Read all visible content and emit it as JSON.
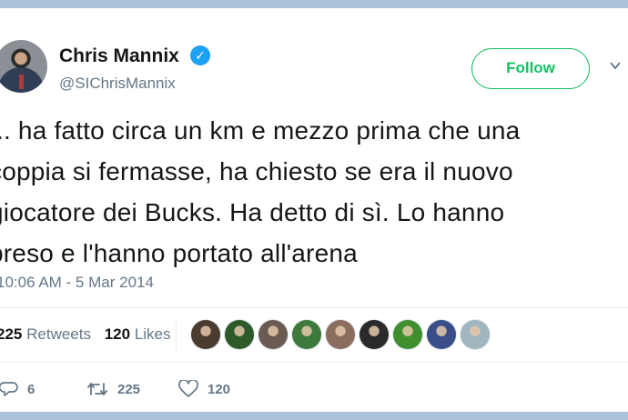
{
  "author": {
    "display_name": "Chris Mannix",
    "handle": "@SIChrisMannix",
    "verified": true
  },
  "follow_label": "Follow",
  "tweet": {
    "lines": [
      "... ha fatto circa un km e mezzo prima che una",
      "coppia si fermasse, ha chiesto se era il nuovo",
      "giocatore dei Bucks. Ha detto di sì. Lo hanno",
      "preso e l'hanno portato all'arena"
    ],
    "timestamp": "10:06 AM - 5 Mar 2014"
  },
  "stats": {
    "retweets_count": "225",
    "retweets_label": "Retweets",
    "likes_count": "120",
    "likes_label": "Likes"
  },
  "likers": [
    {
      "icon": "liker-avatar-1",
      "color": "#4a3b2f"
    },
    {
      "icon": "liker-avatar-2",
      "color": "#2e5a2a"
    },
    {
      "icon": "liker-avatar-3",
      "color": "#6b5a52"
    },
    {
      "icon": "liker-avatar-4",
      "color": "#3e7a3c"
    },
    {
      "icon": "liker-avatar-5",
      "color": "#8a6d5c"
    },
    {
      "icon": "liker-avatar-6",
      "color": "#2a2a2a"
    },
    {
      "icon": "liker-avatar-7",
      "color": "#3f8f2f"
    },
    {
      "icon": "liker-avatar-8",
      "color": "#3a4f8a"
    },
    {
      "icon": "liker-avatar-9",
      "color": "#9fb6bf"
    }
  ],
  "actions": {
    "reply_count": "6",
    "retweet_count": "225",
    "like_count": "120"
  },
  "colors": {
    "frame": "#a9c1d9",
    "follow": "#17bf63",
    "verified": "#1da1f2",
    "secondary_text": "#657786"
  }
}
